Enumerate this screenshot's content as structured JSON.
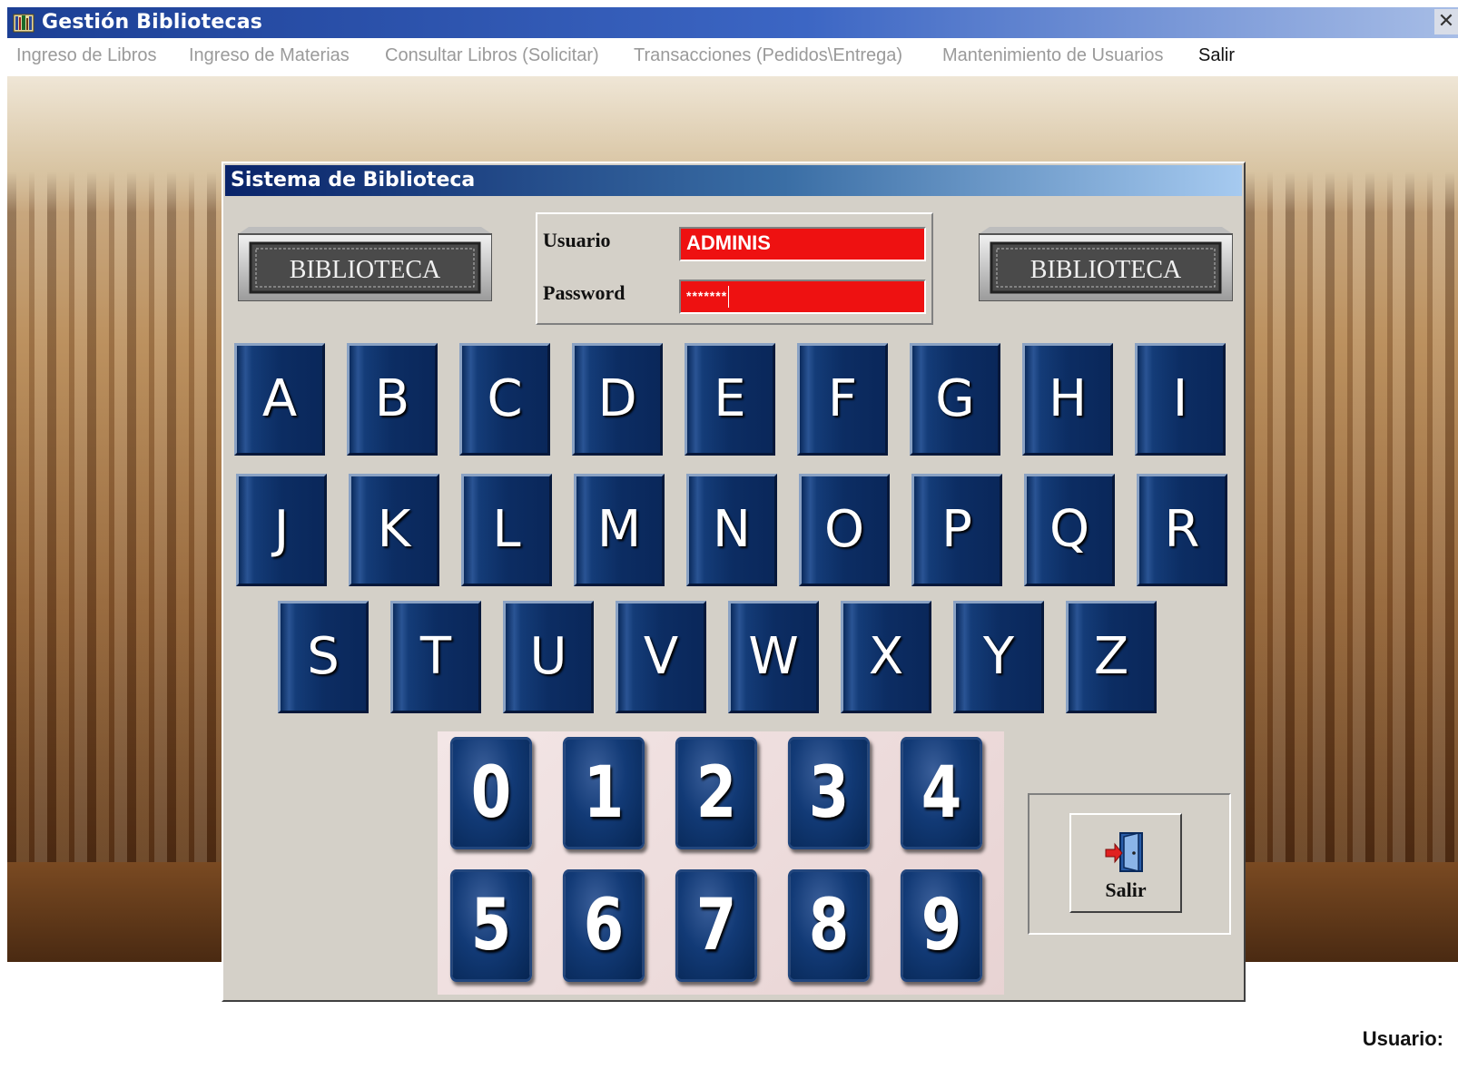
{
  "window": {
    "title": "Gestión Bibliotecas",
    "close_glyph": "✕"
  },
  "menu": {
    "items": [
      {
        "label": "Ingreso de Libros",
        "enabled": false
      },
      {
        "label": "Ingreso de Materias",
        "enabled": false
      },
      {
        "label": "Consultar Libros (Solicitar)",
        "enabled": false
      },
      {
        "label": "Transacciones (Pedidos\\Entrega)",
        "enabled": false
      },
      {
        "label": "Mantenimiento de Usuarios",
        "enabled": false
      },
      {
        "label": "Salir",
        "enabled": true
      }
    ]
  },
  "dialog": {
    "title": "Sistema de Biblioteca",
    "logo_text": "BIBLIOTECA",
    "usuario_label": "Usuario",
    "usuario_value": "ADMINIS",
    "password_label": "Password",
    "password_value": "*******",
    "field_color": "#ee1111",
    "letters": [
      "A",
      "B",
      "C",
      "D",
      "E",
      "F",
      "G",
      "H",
      "I",
      "J",
      "K",
      "L",
      "M",
      "N",
      "O",
      "P",
      "Q",
      "R",
      "S",
      "T",
      "U",
      "V",
      "W",
      "X",
      "Y",
      "Z"
    ],
    "digits": [
      "0",
      "1",
      "2",
      "3",
      "4",
      "5",
      "6",
      "7",
      "8",
      "9"
    ],
    "salir_label": "Salir",
    "salir_icon": "exit-door-icon"
  },
  "status": {
    "usuario_label": "Usuario:"
  }
}
